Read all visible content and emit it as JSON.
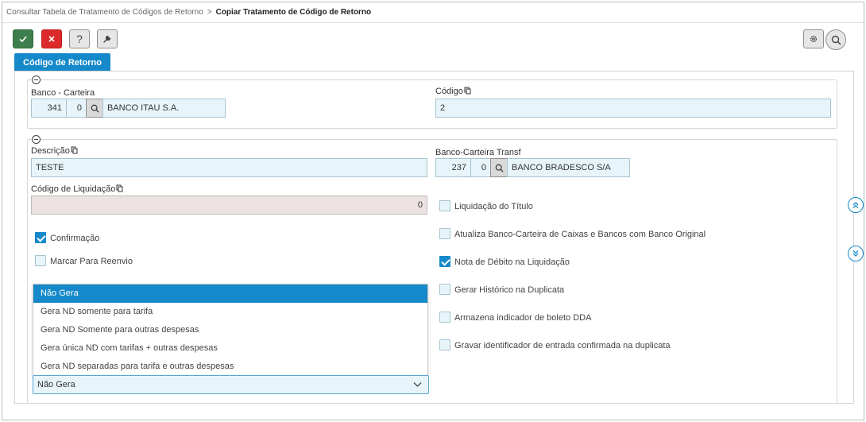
{
  "breadcrumb": {
    "parent": "Consultar Tabela de Tratamento de Códigos de Retorno",
    "separator": ">",
    "current": "Copiar Tratamento de Código de Retorno"
  },
  "toolbar": {
    "confirm_icon": "check-icon",
    "cancel_icon": "close-icon",
    "help_label": "?",
    "tools_icon": "wrench-icon",
    "settings_icon": "gear-icon",
    "search_icon": "search-icon"
  },
  "tab": {
    "label": "Código de Retorno"
  },
  "section1": {
    "banco_carteira_label": "Banco - Carteira",
    "banco": "341",
    "carteira": "0",
    "banco_nome": "BANCO ITAU S.A.",
    "codigo_label": "Código",
    "codigo": "2"
  },
  "section2": {
    "descricao_label": "Descrição",
    "descricao": "TESTE",
    "transf_label": "Banco-Carteira Transf",
    "transf_banco": "237",
    "transf_carteira": "0",
    "transf_nome": "BANCO BRADESCO S/A",
    "liquidacao_label": "Código de Liquidação",
    "liquidacao": "0",
    "left_checks": [
      {
        "label": "Confirmação",
        "checked": true
      },
      {
        "label": "Marcar Para Reenvio",
        "checked": false
      }
    ],
    "right_checks": [
      {
        "label": "Liquidação do Título",
        "checked": false
      },
      {
        "label": "Atualiza Banco-Carteira de Caixas e Bancos com Banco Original",
        "checked": false
      },
      {
        "label": "Nota de Débito na Liquidação",
        "checked": true
      },
      {
        "label": "Gerar Histórico na Duplicata",
        "checked": false
      },
      {
        "label": "Armazena indicador de boleto DDA",
        "checked": false
      },
      {
        "label": "Gravar identificador de entrada confirmada na duplicata",
        "checked": false
      }
    ],
    "nd_options": [
      "Não Gera",
      "Gera ND somente para tarifa",
      "Gera ND Somente para outras despesas",
      "Gera única ND com tarifas + outras despesas",
      "Gera ND separadas para tarifa e outras despesas"
    ],
    "nd_selected": "Não Gera"
  },
  "side_nav": {
    "up_icon": "double-chevron-up-icon",
    "down_icon": "double-chevron-down-icon"
  },
  "colors": {
    "accent": "#1589c9",
    "confirm": "#3c7f4c",
    "cancel": "#dc2a2a",
    "field_bg": "#e7f5fb"
  }
}
